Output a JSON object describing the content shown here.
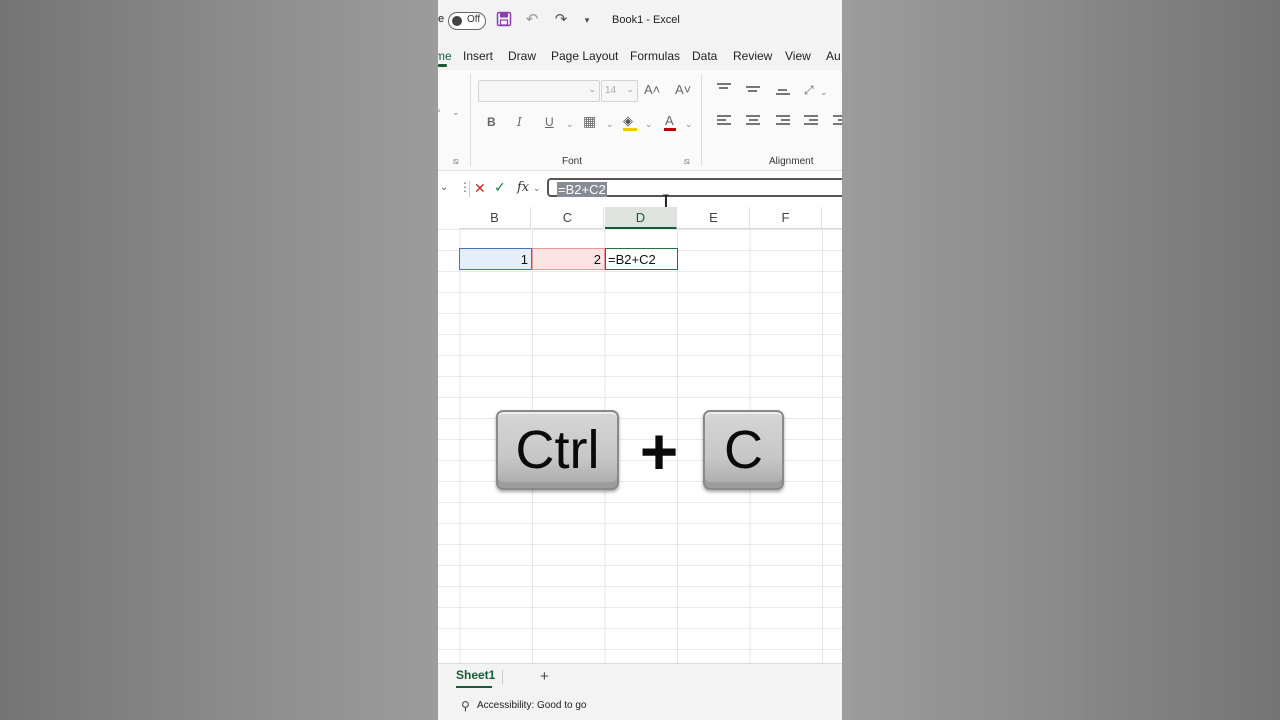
{
  "window": {
    "title": "Book1  -  Excel",
    "autosave_fragment": "e",
    "autosave_state": "Off"
  },
  "tabs": [
    {
      "label": "me",
      "active": true
    },
    {
      "label": "Insert"
    },
    {
      "label": "Draw"
    },
    {
      "label": "Page Layout"
    },
    {
      "label": "Formulas"
    },
    {
      "label": "Data"
    },
    {
      "label": "Review"
    },
    {
      "label": "View"
    },
    {
      "label": "Au"
    }
  ],
  "ribbon": {
    "font": {
      "name": "",
      "size": "14",
      "group_label": "Font"
    },
    "alignment": {
      "group_label": "Alignment"
    },
    "buttons": {
      "bold": "B",
      "italic": "I",
      "underline": "U",
      "font_color": "A",
      "grow": "A˄",
      "shrink": "A˅"
    }
  },
  "formula_bar": {
    "formula": "=B2+C2",
    "fx": "fx"
  },
  "columns": [
    "B",
    "C",
    "D",
    "E",
    "F"
  ],
  "selected_column": "D",
  "cells": {
    "B2": "1",
    "C2": "2",
    "D2": "=B2+C2"
  },
  "shortcut": {
    "key1": "Ctrl",
    "plus": "+",
    "key2": "C"
  },
  "sheets": {
    "active": "Sheet1",
    "add": "+"
  },
  "status": {
    "accessibility": "Accessibility: Good to go"
  },
  "colors": {
    "excel_green": "#185c37",
    "b2_ref": "#4472c4",
    "c2_ref": "#e89a9a",
    "save_purple": "#8a3fae"
  }
}
